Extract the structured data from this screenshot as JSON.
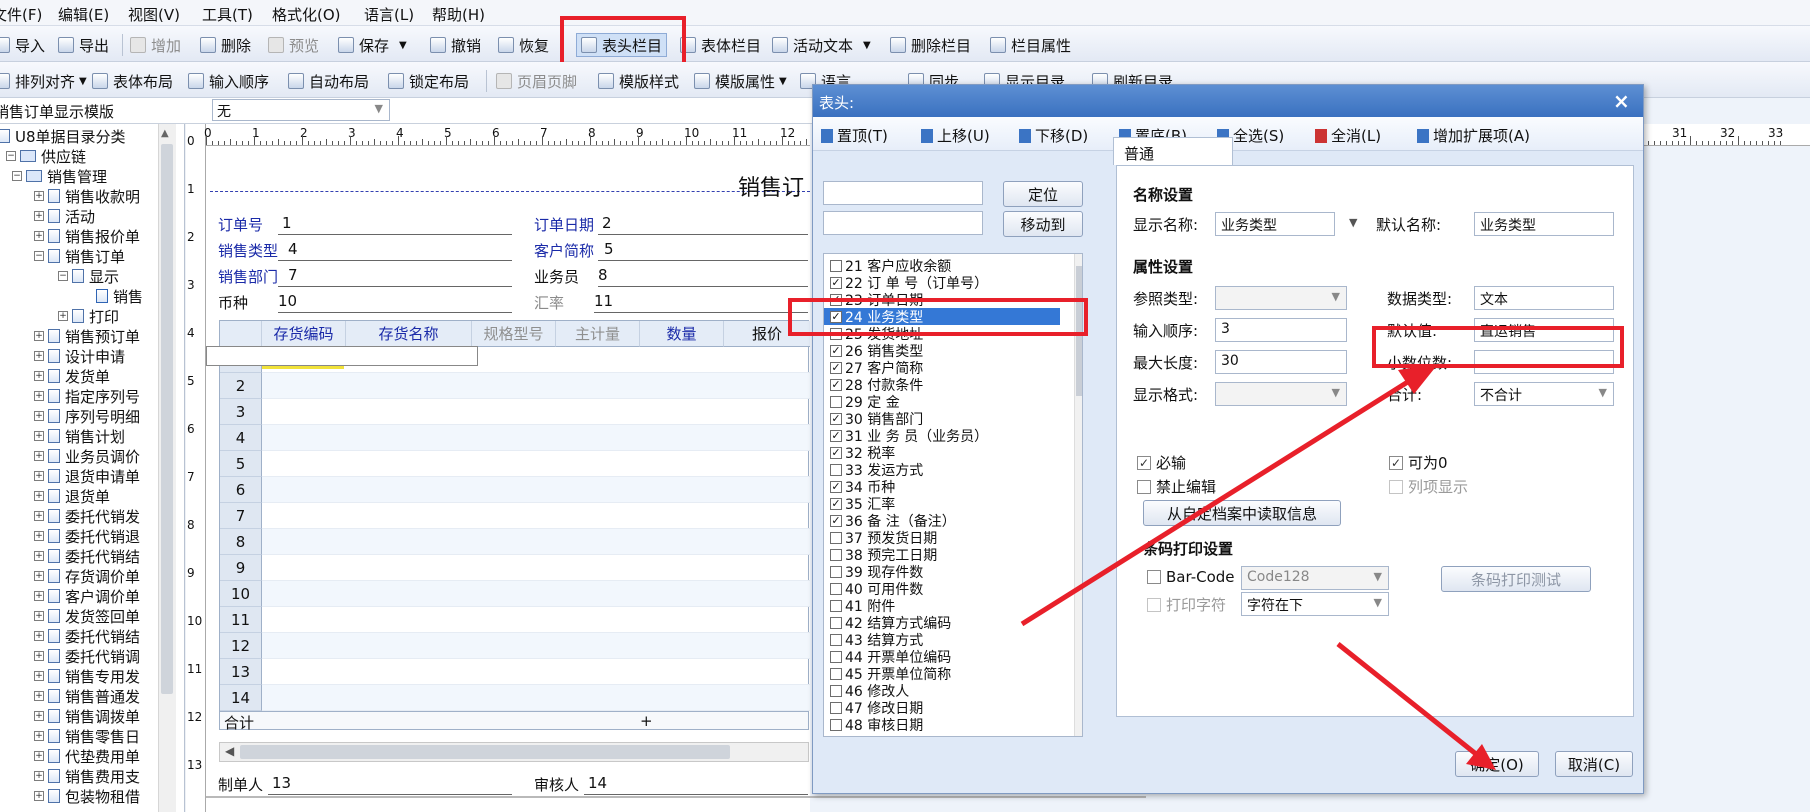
{
  "menubar": {
    "items": [
      "文件(F)",
      "编辑(E)",
      "视图(V)",
      "工具(T)",
      "格式化(O)",
      "语言(L)",
      "帮助(H)"
    ]
  },
  "toolbar1": {
    "items": [
      "导入",
      "导出",
      "增加",
      "删除",
      "预览",
      "保存",
      "撤销",
      "恢复",
      "表头栏目",
      "表体栏目",
      "活动文本",
      "删除栏目",
      "栏目属性"
    ]
  },
  "toolbar2": {
    "items": [
      "排列对齐",
      "表体布局",
      "输入顺序",
      "自动布局",
      "锁定布局",
      "页眉页脚",
      "模版样式",
      "模版属性",
      "语言",
      "同步",
      "显示目录",
      "刷新目录"
    ]
  },
  "template_selector": {
    "label": "销售订单显示模版",
    "value": "无"
  },
  "tree": {
    "root": "U8单据目录分类",
    "nodes": [
      "供应链",
      "销售管理",
      "销售收款明",
      "活动",
      "销售报价单",
      "销售订单",
      "显示",
      "销售",
      "打印",
      "销售预订单",
      "设计申请",
      "发货单",
      "指定序列号",
      "序列号明细",
      "销售计划",
      "业务员调价",
      "退货申请单",
      "退货单",
      "委托代销发",
      "委托代销退",
      "委托代销结",
      "存货调价单",
      "客户调价单",
      "发货签回单",
      "委托代销结",
      "委托代销调",
      "销售专用发",
      "销售普通发",
      "销售调拨单",
      "销售零售日",
      "代垫费用单",
      "销售费用支",
      "包装物租借"
    ]
  },
  "design": {
    "title": "销售订",
    "ruler_numbers": [
      "0",
      "1",
      "2",
      "3",
      "4",
      "5",
      "6",
      "7",
      "8",
      "9",
      "10",
      "11",
      "12"
    ],
    "ruler_right": [
      "31",
      "32",
      "33"
    ],
    "vruler_numbers": [
      "0",
      "1",
      "2",
      "3",
      "4",
      "5",
      "6",
      "7",
      "8",
      "9",
      "10",
      "11",
      "12",
      "13"
    ],
    "fields": [
      {
        "label": "订单号",
        "value": "1"
      },
      {
        "label": "订单日期",
        "value": "2"
      },
      {
        "label": "销售类型",
        "value": "4"
      },
      {
        "label": "客户简称",
        "value": "5"
      },
      {
        "label": "销售部门",
        "value": "7"
      },
      {
        "label": "业务员",
        "value": "8"
      },
      {
        "label": "币种",
        "value": "10"
      },
      {
        "label": "汇率",
        "value": "11"
      }
    ],
    "columns": [
      "存货编码",
      "存货名称",
      "规格型号",
      "主计量",
      "数量",
      "报价"
    ],
    "rows": [
      "2",
      "3",
      "4",
      "5",
      "6",
      "7",
      "8",
      "9",
      "10",
      "11",
      "12",
      "13",
      "14"
    ],
    "total_label": "合计",
    "total_plus": "+",
    "footer": [
      {
        "label": "制单人",
        "value": "13"
      },
      {
        "label": "审核人",
        "value": "14"
      }
    ]
  },
  "dialog": {
    "title": "表头:",
    "close": "×",
    "toolbar": [
      "置顶(T)",
      "上移(U)",
      "下移(D)",
      "置底(B)",
      "全选(S)",
      "全消(L)",
      "增加扩展项(A)"
    ],
    "locate_button": "定位",
    "moveto_button": "移动到",
    "field_list": [
      {
        "text": "21  客户应收余额",
        "checked": false
      },
      {
        "text": "22  订 单 号（订单号）",
        "checked": true
      },
      {
        "text": "23  订单日期",
        "checked": true
      },
      {
        "text": "24  业务类型",
        "checked": true,
        "selected": true
      },
      {
        "text": "25  发货地址",
        "checked": false
      },
      {
        "text": "26  销售类型",
        "checked": true
      },
      {
        "text": "27  客户简称",
        "checked": true
      },
      {
        "text": "28  付款条件",
        "checked": true
      },
      {
        "text": "29  定    金",
        "checked": false
      },
      {
        "text": "30  销售部门",
        "checked": true
      },
      {
        "text": "31  业 务 员（业务员）",
        "checked": true
      },
      {
        "text": "32  税率",
        "checked": true
      },
      {
        "text": "33  发运方式",
        "checked": false
      },
      {
        "text": "34  币种",
        "checked": true
      },
      {
        "text": "35  汇率",
        "checked": true
      },
      {
        "text": "36  备    注（备注）",
        "checked": true
      },
      {
        "text": "37  预发货日期",
        "checked": false
      },
      {
        "text": "38  预完工日期",
        "checked": false
      },
      {
        "text": "39  现存件数",
        "checked": false
      },
      {
        "text": "40  可用件数",
        "checked": false
      },
      {
        "text": "41  附件",
        "checked": false
      },
      {
        "text": "42  结算方式编码",
        "checked": false
      },
      {
        "text": "43  结算方式",
        "checked": false
      },
      {
        "text": "44  开票单位编码",
        "checked": false
      },
      {
        "text": "45  开票单位简称",
        "checked": false
      },
      {
        "text": "46  修改人",
        "checked": false
      },
      {
        "text": "47  修改日期",
        "checked": false
      },
      {
        "text": "48  审核日期",
        "checked": false
      }
    ],
    "tab": "普通",
    "name_section": "名称设置",
    "display_name_label": "显示名称:",
    "display_name_value": "业务类型",
    "default_name_label": "默认名称:",
    "default_name_value": "业务类型",
    "attr_section": "属性设置",
    "ref_type_label": "参照类型:",
    "data_type_label": "数据类型:",
    "data_type_value": "文本",
    "input_order_label": "输入顺序:",
    "input_order_value": "3",
    "default_value_label": "默认值:",
    "default_value_value": "直运销售",
    "max_len_label": "最大长度:",
    "max_len_value": "30",
    "decimals_label": "小数位数:",
    "format_label": "显示格式:",
    "sum_label": "合计:",
    "sum_value": "不合计",
    "required_label": "必输",
    "allow_zero_label": "可为0",
    "no_edit_label": "禁止编辑",
    "list_show_label": "列项显示",
    "read_custom_button": "从自定档案中读取信息",
    "barcode_section": "条码打印设置",
    "barcode_label": "Bar-Code",
    "barcode_type": "Code128",
    "print_char_label": "打印字符",
    "print_char_pos": "字符在下",
    "barcode_test_button": "条码打印测试",
    "ok_button": "确定(O)",
    "cancel_button": "取消(C)"
  },
  "colors": {
    "annotation_red": "#e8202a",
    "title_blue": "#3a71c0",
    "selection_blue": "#3478d6"
  }
}
